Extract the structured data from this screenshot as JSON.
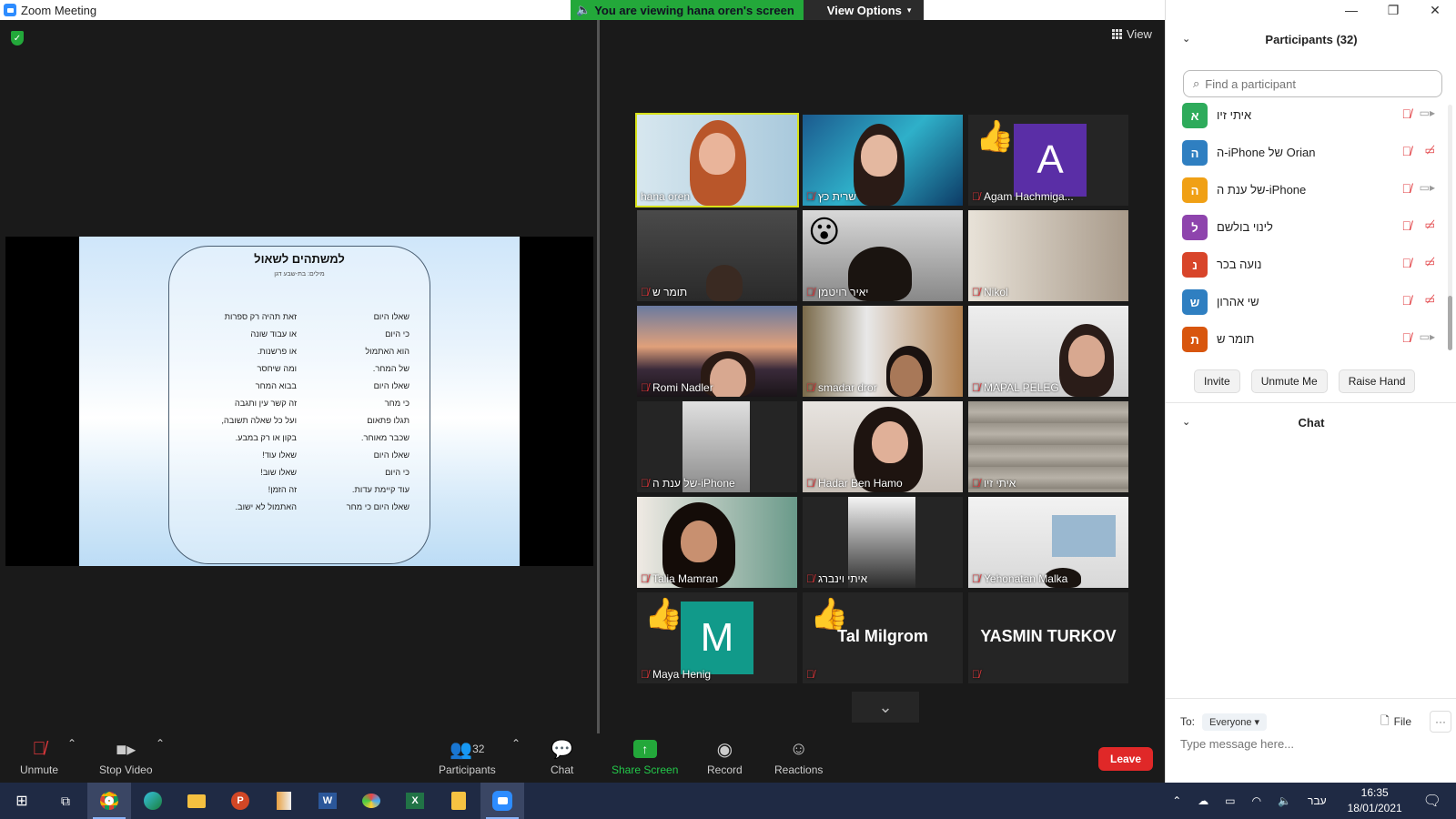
{
  "window": {
    "title": "Zoom Meeting"
  },
  "banner": {
    "viewing": "You are viewing hana oren's screen",
    "view_options": "View Options"
  },
  "view_label": "View",
  "slide": {
    "title": "למשתהים לשאול",
    "subtitle": "מילים: בת-שבע דגן",
    "lines": [
      {
        "right": "שאלו  היום",
        "left": "זאת תהיה רק ספרות"
      },
      {
        "right": "כי היום",
        "left": "או עבוד שונה"
      },
      {
        "right": "הוא האתמול",
        "left": "או פרשנות."
      },
      {
        "right": "של המחר.",
        "left": "ומה שיחסר"
      },
      {
        "right": "שאלו היום",
        "left": "בבוא המחר"
      },
      {
        "right": "כי מחר",
        "left": "זה קשר עין ותגבה"
      },
      {
        "right": "תגלו פתאום",
        "left": "ועל כל שאלה תשובה,"
      },
      {
        "right": "שכבר מאוחר.",
        "left": "בקון או רק במבע."
      },
      {
        "right": "שאלו היום",
        "left": "שאלו עוד!"
      },
      {
        "right": "כי היום",
        "left": "שאלו שוב!"
      },
      {
        "right": "עוד קיימת עדות.",
        "left": "זה הזמן!"
      },
      {
        "right": "שאלו היום כי מחר",
        "left": "האתמול לא ישוב."
      }
    ]
  },
  "tiles": [
    {
      "name": "hana oren",
      "muted": false
    },
    {
      "name": "שרית כץ",
      "muted": true
    },
    {
      "name": "Agam Hachmiga...",
      "muted": true,
      "initial": "A"
    },
    {
      "name": "תומר ש",
      "muted": true
    },
    {
      "name": "יאיר רויטמן",
      "muted": true
    },
    {
      "name": "Nikol",
      "muted": true
    },
    {
      "name": "Romi Nadler",
      "muted": true
    },
    {
      "name": "smadar dror",
      "muted": true
    },
    {
      "name": "MAPAL PELEG",
      "muted": true
    },
    {
      "name": "של ענת ה-iPhone",
      "muted": true
    },
    {
      "name": "Hadar Ben Hamo",
      "muted": true
    },
    {
      "name": "איתי זיו",
      "muted": true
    },
    {
      "name": "Talia Mamran",
      "muted": true
    },
    {
      "name": "איתי וינברג",
      "muted": true
    },
    {
      "name": "Yehonatan Malka",
      "muted": true
    },
    {
      "name": "Maya Henig",
      "muted": true,
      "initial": "M"
    },
    {
      "name": "Tal Milgrom",
      "muted": true
    },
    {
      "name": "YASMIN TURKOV",
      "muted": true
    }
  ],
  "participants_panel": {
    "header": "Participants (32)",
    "search_placeholder": "Find a participant",
    "list": [
      {
        "initial": "א",
        "name": "איתי זיו",
        "color": "#2eab5b",
        "video_off": false
      },
      {
        "initial": "ה",
        "name": "ה-iPhone של Orian",
        "color": "#2f7fc1",
        "video_off": true
      },
      {
        "initial": "ה",
        "name": "של ענת ה-iPhone",
        "color": "#f0a015",
        "video_off": false
      },
      {
        "initial": "ל",
        "name": "לינוי בולשם",
        "color": "#8e44ad",
        "video_off": true
      },
      {
        "initial": "נ",
        "name": "נועה בכר",
        "color": "#d8452a",
        "video_off": true
      },
      {
        "initial": "ש",
        "name": "שי אהרון",
        "color": "#2f7fc1",
        "video_off": true
      },
      {
        "initial": "ת",
        "name": "תומר ש",
        "color": "#d8560e",
        "video_off": false
      }
    ],
    "invite": "Invite",
    "unmute_me": "Unmute Me",
    "raise_hand": "Raise Hand"
  },
  "chat": {
    "header": "Chat",
    "to_label": "To:",
    "to_value": "Everyone",
    "file": "File",
    "placeholder": "Type message here..."
  },
  "toolbar": {
    "unmute": "Unmute",
    "stop_video": "Stop Video",
    "participants": "Participants",
    "participants_count": "32",
    "chat": "Chat",
    "share_screen": "Share Screen",
    "record": "Record",
    "reactions": "Reactions",
    "leave": "Leave"
  },
  "taskbar": {
    "lang": "עבר",
    "time": "16:35",
    "date": "18/01/2021"
  }
}
